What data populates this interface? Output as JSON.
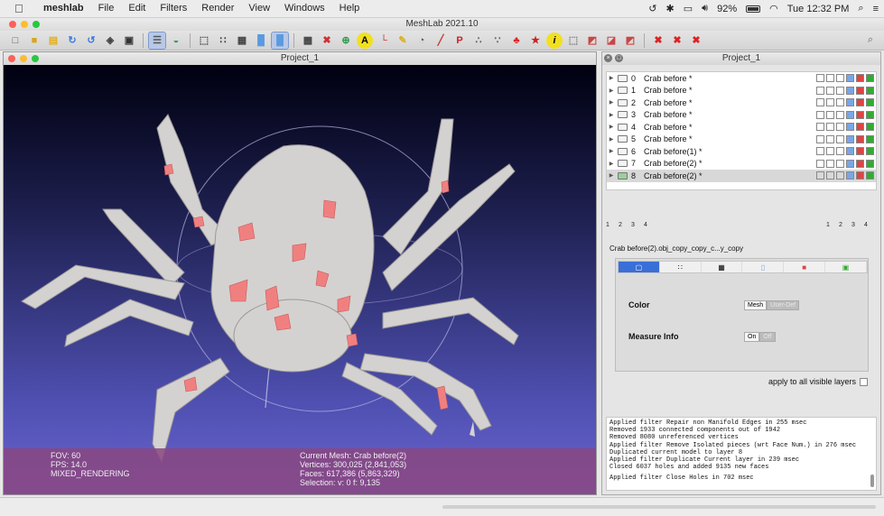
{
  "menubar": {
    "app": "meshlab",
    "items": [
      "File",
      "Edit",
      "Filters",
      "Render",
      "View",
      "Windows",
      "Help"
    ],
    "battery": "92%",
    "clock": "Tue 12:32 PM"
  },
  "window": {
    "title": "MeshLab 2021.10"
  },
  "left_panel": {
    "title": "Project_1"
  },
  "right_panel": {
    "title": "Project_1"
  },
  "hud": {
    "fov": "FOV: 60",
    "fps": "FPS:    14.0",
    "mode": "MIXED_RENDERING",
    "current_mesh": "Current Mesh: Crab before(2)",
    "vertices": "Vertices: 300,025    (2,841,053)",
    "faces": "Faces: 617,386    (5,863,329)",
    "selection": "Selection: v: 0 f: 9,135"
  },
  "layers": [
    {
      "index": "0",
      "name": "Crab before *"
    },
    {
      "index": "1",
      "name": "Crab before *"
    },
    {
      "index": "2",
      "name": "Crab before *"
    },
    {
      "index": "3",
      "name": "Crab before *"
    },
    {
      "index": "4",
      "name": "Crab before *"
    },
    {
      "index": "5",
      "name": "Crab before *"
    },
    {
      "index": "6",
      "name": "Crab before(1) *"
    },
    {
      "index": "7",
      "name": "Crab before(2) *"
    },
    {
      "index": "8",
      "name": "Crab before(2) *"
    }
  ],
  "tag_numbers": [
    "1",
    "2",
    "3",
    "4"
  ],
  "mesh_label": "Crab before(2).obj_copy_copy_c...y_copy",
  "decorators": {
    "color_label": "Color",
    "color_opt_a": "Mesh",
    "color_opt_b": "User-Def",
    "measure_label": "Measure Info",
    "measure_on": "On",
    "measure_off": "Off",
    "apply_all": "apply to all visible layers"
  },
  "log": [
    "Applied filter Repair non Manifold Edges in 255 msec",
    "Removed 1933 connected components out of 1942",
    "Removed 8080 unreferenced vertices",
    "Applied filter Remove Isolated pieces (wrt Face Num.) in 276 msec",
    "Duplicated current model to layer 8",
    "Applied filter Duplicate Current layer in 239 msec",
    "Closed 6037 holes and added 9135 new faces",
    "",
    "Applied filter Close Holes in 702 msec"
  ],
  "colors": {
    "selection_red": "#f08080",
    "viewport_bottom": "#6a64d0",
    "hud": "#8a4680"
  }
}
